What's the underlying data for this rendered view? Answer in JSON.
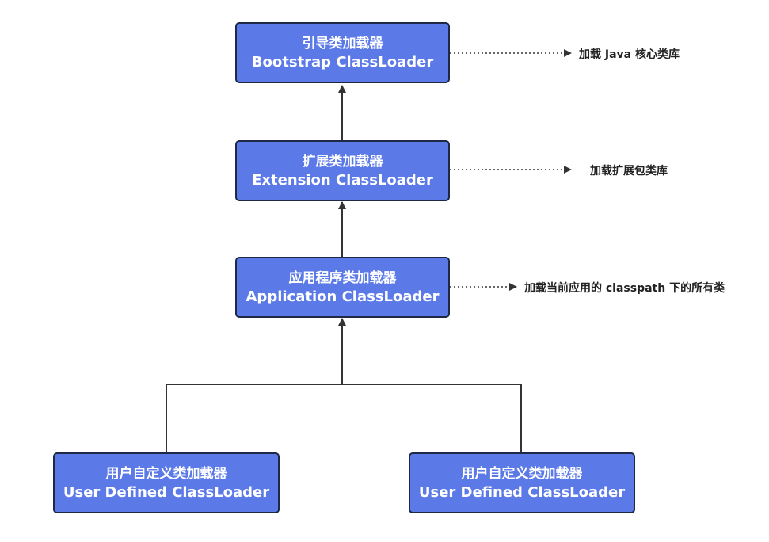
{
  "colors": {
    "box_fill": "#5b7ae8",
    "box_border": "#1e2a45",
    "line": "#333333"
  },
  "nodes": {
    "bootstrap": {
      "zh": "引导类加载器",
      "en": "Bootstrap ClassLoader"
    },
    "extension": {
      "zh": "扩展类加载器",
      "en": "Extension ClassLoader"
    },
    "application": {
      "zh": "应用程序类加载器",
      "en": "Application ClassLoader"
    },
    "user1": {
      "zh": "用户自定义类加载器",
      "en": "User Defined ClassLoader"
    },
    "user2": {
      "zh": "用户自定义类加载器",
      "en": "User Defined ClassLoader"
    }
  },
  "notes": {
    "bootstrap": "加载 Java 核心类库",
    "extension": "加载扩展包类库",
    "application": "加载当前应用的 classpath 下的所有类"
  }
}
